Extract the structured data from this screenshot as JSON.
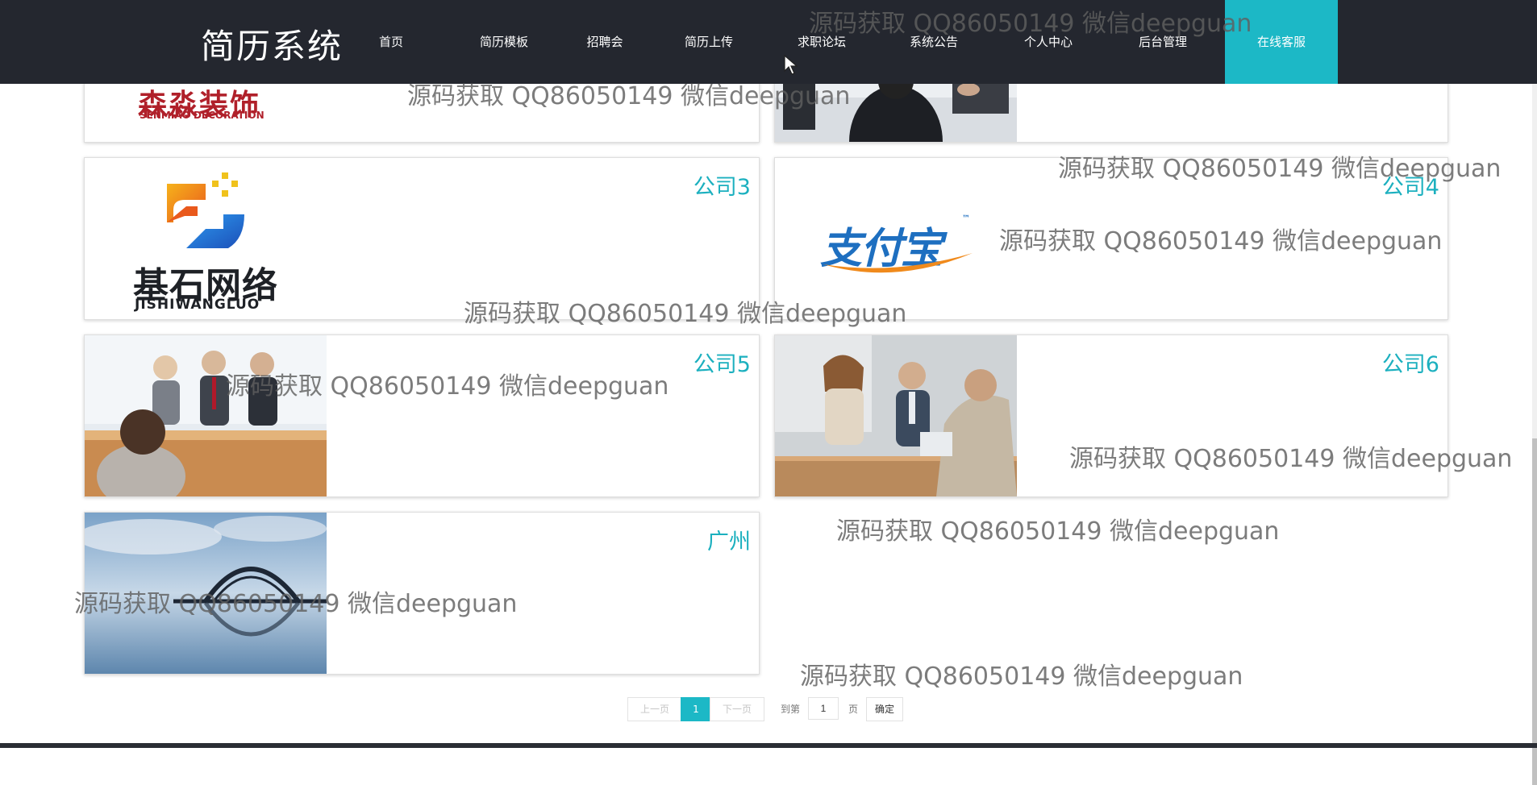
{
  "app": {
    "brand": "简历系统"
  },
  "nav": {
    "items": [
      {
        "label": "首页"
      },
      {
        "label": "简历模板"
      },
      {
        "label": "招聘会"
      },
      {
        "label": "简历上传"
      },
      {
        "label": "求职论坛"
      },
      {
        "label": "系统公告"
      },
      {
        "label": "个人中心"
      },
      {
        "label": "后台管理"
      },
      {
        "label": "在线客服"
      }
    ],
    "active_index": 8
  },
  "cards": [
    {
      "title": "",
      "logo": "森淼装饰",
      "logo_sub": "SENMIAO DECORATION"
    },
    {
      "title": "",
      "image": "interview-photo"
    },
    {
      "title": "公司3",
      "logo": "基石网络",
      "logo_sub": "JISHIWANGLUO"
    },
    {
      "title": "公司4",
      "logo": "支付宝",
      "logo_sub": "™"
    },
    {
      "title": "公司5",
      "image": "team-interview-photo"
    },
    {
      "title": "公司6",
      "image": "office-meeting-photo"
    },
    {
      "title": "广州",
      "image": "bridge-lake-photo"
    }
  ],
  "watermark": "源码获取 QQ86050149 微信deepguan",
  "pagination": {
    "prev": "上一页",
    "current": "1",
    "next": "下一页",
    "goto_label": "到第",
    "page_value": "1",
    "page_unit": "页",
    "confirm": "确定"
  },
  "colors": {
    "nav_bg": "#24272f",
    "accent": "#1cb8c6",
    "title": "#1cb0bf"
  }
}
